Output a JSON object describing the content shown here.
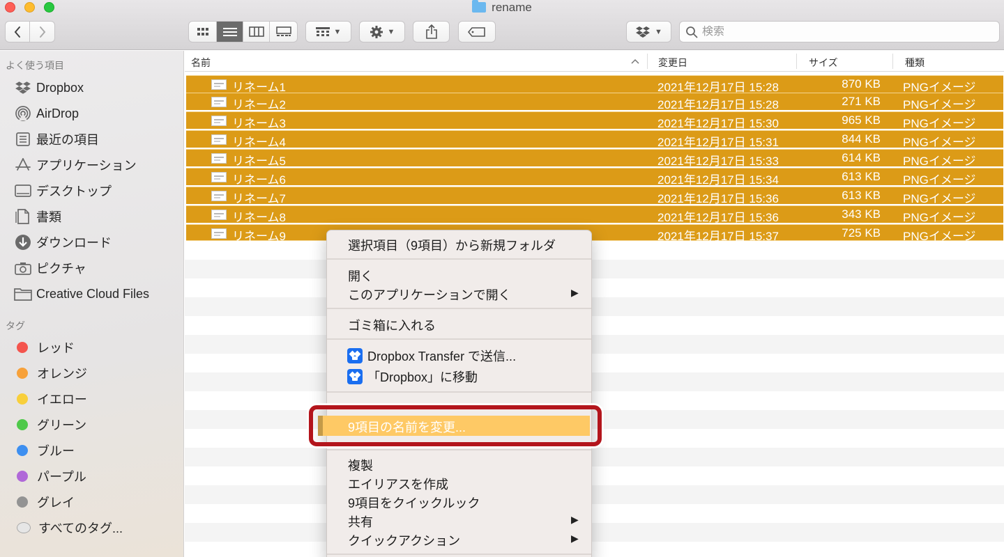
{
  "window": {
    "title": "rename"
  },
  "toolbar": {
    "back_icon": "chevron-left-icon",
    "forward_icon": "chevron-right-icon",
    "view_modes": [
      "icon-view",
      "list-view",
      "column-view",
      "gallery-view"
    ],
    "active_view": "list-view",
    "search_placeholder": "検索"
  },
  "sidebar": {
    "favorites_header": "よく使う項目",
    "favorites": [
      {
        "label": "Dropbox",
        "icon": "dropbox-icon"
      },
      {
        "label": "AirDrop",
        "icon": "airdrop-icon"
      },
      {
        "label": "最近の項目",
        "icon": "recents-icon"
      },
      {
        "label": "アプリケーション",
        "icon": "applications-icon"
      },
      {
        "label": "デスクトップ",
        "icon": "desktop-icon"
      },
      {
        "label": "書類",
        "icon": "documents-icon"
      },
      {
        "label": "ダウンロード",
        "icon": "downloads-icon"
      },
      {
        "label": "ピクチャ",
        "icon": "pictures-icon"
      },
      {
        "label": "Creative Cloud Files",
        "icon": "folder-icon"
      }
    ],
    "tags_header": "タグ",
    "tags": [
      {
        "label": "レッド",
        "color": "#f4544d"
      },
      {
        "label": "オレンジ",
        "color": "#f7a13a"
      },
      {
        "label": "イエロー",
        "color": "#f8cf3b"
      },
      {
        "label": "グリーン",
        "color": "#4fc94a"
      },
      {
        "label": "ブルー",
        "color": "#3d8ff0"
      },
      {
        "label": "パープル",
        "color": "#b068d8"
      },
      {
        "label": "グレイ",
        "color": "#939393"
      },
      {
        "label": "すべてのタグ...",
        "color": "all-tags"
      }
    ]
  },
  "list": {
    "columns": {
      "name": "名前",
      "date": "変更日",
      "size": "サイズ",
      "kind": "種類"
    },
    "selection_color": "#dc9b17",
    "files": [
      {
        "name": "リネーム1",
        "date": "2021年12月17日 15:28",
        "size": "870 KB",
        "kind": "PNGイメージ"
      },
      {
        "name": "リネーム2",
        "date": "2021年12月17日 15:28",
        "size": "271 KB",
        "kind": "PNGイメージ"
      },
      {
        "name": "リネーム3",
        "date": "2021年12月17日 15:30",
        "size": "965 KB",
        "kind": "PNGイメージ"
      },
      {
        "name": "リネーム4",
        "date": "2021年12月17日 15:31",
        "size": "844 KB",
        "kind": "PNGイメージ"
      },
      {
        "name": "リネーム5",
        "date": "2021年12月17日 15:33",
        "size": "614 KB",
        "kind": "PNGイメージ"
      },
      {
        "name": "リネーム6",
        "date": "2021年12月17日 15:34",
        "size": "613 KB",
        "kind": "PNGイメージ"
      },
      {
        "name": "リネーム7",
        "date": "2021年12月17日 15:36",
        "size": "613 KB",
        "kind": "PNGイメージ"
      },
      {
        "name": "リネーム8",
        "date": "2021年12月17日 15:36",
        "size": "343 KB",
        "kind": "PNGイメージ"
      },
      {
        "name": "リネーム9",
        "date": "2021年12月17日 15:37",
        "size": "725 KB",
        "kind": "PNGイメージ"
      }
    ]
  },
  "context_menu": {
    "new_folder": "選択項目（9項目）から新規フォルダ",
    "open": "開く",
    "open_with": "このアプリケーションで開く",
    "trash": "ゴミ箱に入れる",
    "dropbox_transfer": "Dropbox Transfer で送信...",
    "move_to_dropbox": "「Dropbox」に移動",
    "rename": "9項目の名前を変更...",
    "duplicate": "複製",
    "make_alias": "エイリアスを作成",
    "quick_look": "9項目をクイックルック",
    "share": "共有",
    "quick_actions": "クイックアクション",
    "highlight_color": "#fec965",
    "callout_color": "#b3151c"
  }
}
